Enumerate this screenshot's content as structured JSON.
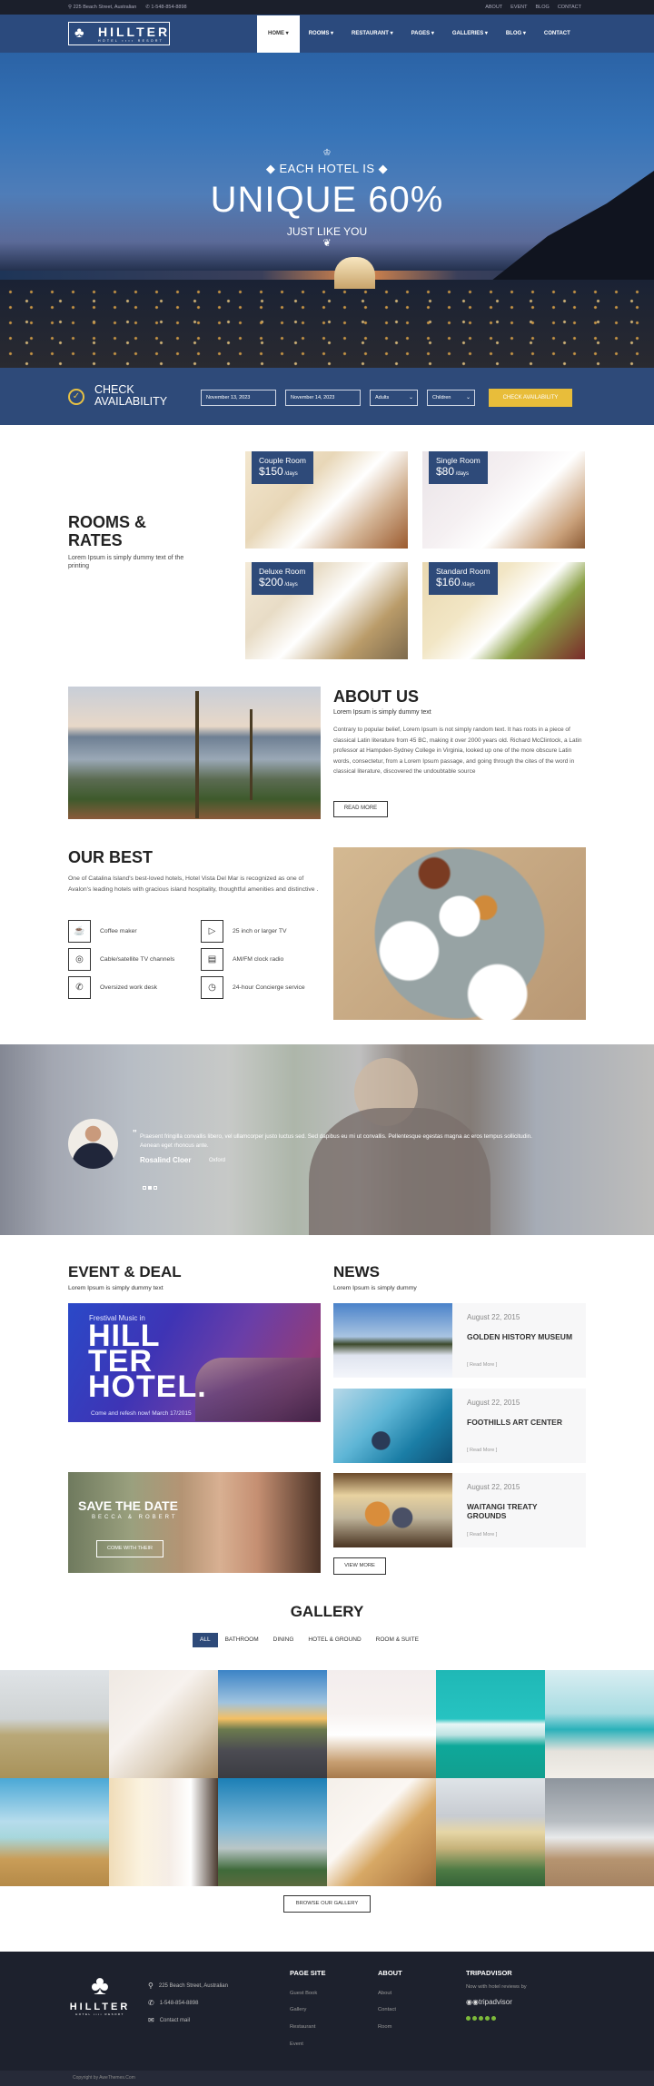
{
  "topbar": {
    "address": "225 Beach Street, Australian",
    "phone": "1-548-854-8898",
    "links": [
      "ABOUT",
      "EVENT",
      "BLOG",
      "CONTACT"
    ]
  },
  "navbar": {
    "logo_name": "HILLTER",
    "logo_sub": "HOTEL ▪▪▪▪ RESORT",
    "menu": [
      {
        "label": "HOME ▾",
        "active": true
      },
      {
        "label": "ROOMS ▾"
      },
      {
        "label": "RESTAURANT ▾"
      },
      {
        "label": "PAGES ▾"
      },
      {
        "label": "GALLERIES ▾"
      },
      {
        "label": "BLOG ▾"
      },
      {
        "label": "CONTACT"
      }
    ]
  },
  "hero": {
    "pre": "◆ EACH HOTEL IS ◆",
    "title": "UNIQUE 60%",
    "post": "JUST LIKE YOU"
  },
  "availability": {
    "title_line1": "CHECK",
    "title_line2": "AVAILABILITY",
    "arrival": "November 13, 2023",
    "departure": "November 14, 2023",
    "adults": "Adults",
    "children": "Children",
    "button": "CHECK AVAILABILITY"
  },
  "rooms": {
    "title_line1": "ROOMS &",
    "title_line2": "RATES",
    "desc": "Lorem Ipsum is simply dummy text of the printing",
    "items": [
      {
        "name": "Couple Room",
        "price": "$150",
        "unit": " /days"
      },
      {
        "name": "Single Room",
        "price": "$80",
        "unit": " /days"
      },
      {
        "name": "Deluxe Room",
        "price": "$200",
        "unit": " /days"
      },
      {
        "name": "Standard Room",
        "price": "$160",
        "unit": " /days"
      }
    ]
  },
  "about": {
    "title": "ABOUT US",
    "subtitle": "Lorem Ipsum is simply dummy text",
    "body": "Contrary to popular belief, Lorem Ipsum is not simply random text. It has roots in a piece of classical Latin literature from 45 BC, making it over 2000 years old. Richard McClintock, a Latin professor at Hampden-Sydney College in Virginia, looked up one of the more obscure Latin words, consectetur, from a Lorem Ipsum passage, and going through the cites of the word in classical literature, discovered the undoubtable source",
    "button": "READ MORE"
  },
  "best": {
    "title": "OUR BEST",
    "desc": "One of Catalina Island's best-loved hotels, Hotel Vista Del Mar is recognized as one of Avalon's leading hotels with gracious island hospitality, thoughtful amenities and distinctive .",
    "amenities": [
      {
        "icon": "coffee-maker-icon",
        "glyph": "☕",
        "label": "Coffee maker"
      },
      {
        "icon": "tv-play-icon",
        "glyph": "▷",
        "label": "25 inch or larger TV"
      },
      {
        "icon": "satellite-icon",
        "glyph": "◎",
        "label": "Cable/satellite TV channels"
      },
      {
        "icon": "radio-icon",
        "glyph": "▤",
        "label": "AM/FM clock radio"
      },
      {
        "icon": "phone-icon",
        "glyph": "✆",
        "label": "Oversized work desk"
      },
      {
        "icon": "clock-icon",
        "glyph": "◷",
        "label": "24-hour Concierge service"
      }
    ]
  },
  "testimonial": {
    "quote": "Praesent fringilla convallis libero, vel ullamcorper justo luctus sed. Sed dapibus eu mi ut convallis. Pellentesque egestas magna ac eros tempus sollicitudin. Aenean eget rhoncus ante.",
    "name": "Rosalind Cloer",
    "place": "Oxford",
    "active_slide": 2,
    "slides": 3
  },
  "event": {
    "title": "EVENT & DEAL",
    "subtitle": "Lorem Ipsum is simply dummy text",
    "card1": {
      "pre": "Frestival Music in",
      "big1": "HILL",
      "big2": "TER",
      "big3": "HOTEL.",
      "foot": "Come and refesh now! March 17/2015"
    },
    "card2": {
      "title": "SAVE THE DATE",
      "names": "BECCA & ROBERT",
      "button": "COME WITH THEIR"
    }
  },
  "news": {
    "title": "NEWS",
    "subtitle": "Lorem Ipsum is simply dummy",
    "items": [
      {
        "date": "August 22, 2015",
        "title": "GOLDEN HISTORY MUSEUM",
        "more": "[ Read More ]"
      },
      {
        "date": "August 22, 2015",
        "title": "FOOTHILLS ART CENTER",
        "more": "[ Read More ]"
      },
      {
        "date": "August 22, 2015",
        "title": "WAITANGI TREATY GROUNDS",
        "more": "[ Read More ]"
      }
    ],
    "button": "VIEW MORE"
  },
  "gallery": {
    "title": "GALLERY",
    "tabs": [
      {
        "label": "ALL",
        "active": true
      },
      {
        "label": "BATHROOM"
      },
      {
        "label": "DINING"
      },
      {
        "label": "HOTEL & GROUND"
      },
      {
        "label": "ROOM & SUITE"
      }
    ],
    "tiles": [
      {
        "subject": "sandy beach cloudy"
      },
      {
        "subject": "living room"
      },
      {
        "subject": "coastal road sunset"
      },
      {
        "subject": "bedroom"
      },
      {
        "subject": "turquoise pool"
      },
      {
        "subject": "beach pier"
      },
      {
        "subject": "beach footprints"
      },
      {
        "subject": "bedroom curtains"
      },
      {
        "subject": "hotel building aerial"
      },
      {
        "subject": "bedroom balcony"
      },
      {
        "subject": "beach dunes"
      },
      {
        "subject": "beach storm"
      }
    ],
    "button": "BROWSE OUR GALLERY"
  },
  "footer": {
    "logo_name": "HILLTER",
    "logo_sub": "HOTEL ▪▪▪▪ RESORT",
    "address": "225 Beach Street, Australian",
    "phone": "1-548-854-8898",
    "mail": "Contact mail",
    "page_site_title": "PAGE SITE",
    "page_site_links": [
      "Guest Book",
      "Gallery",
      "Restaurant",
      "Event"
    ],
    "about_title": "ABOUT",
    "about_links": [
      "About",
      "Contact",
      "Room"
    ],
    "tripadvisor_title": "TRIPADVISOR",
    "tripadvisor_text": "Now with hotel reviews by",
    "tripadvisor_logo": "tripadvisor",
    "rating": 5,
    "copyright": "Copyright by AweThemes.Com"
  }
}
